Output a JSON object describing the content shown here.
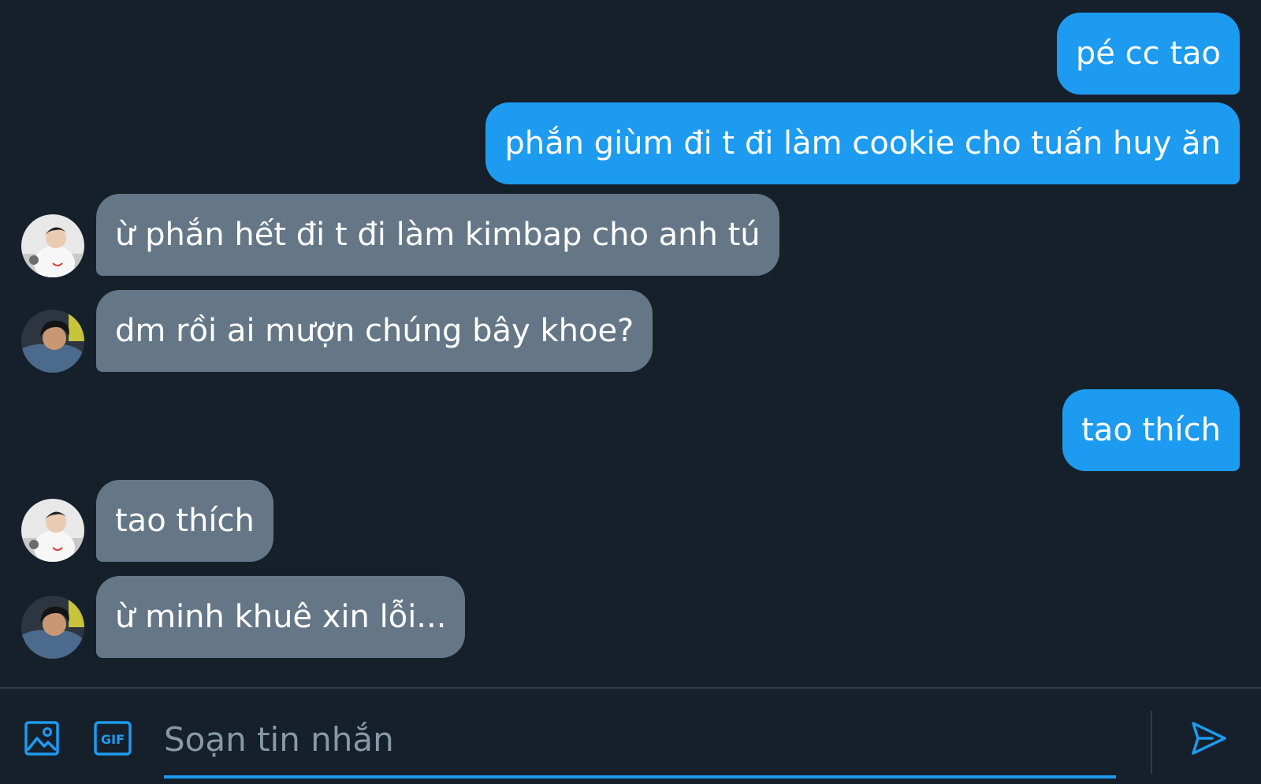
{
  "colors": {
    "background": "#15202b",
    "outgoing": "#1d9bf0",
    "incoming": "#657786",
    "accent": "#1d9bf0"
  },
  "messages": [
    {
      "direction": "out",
      "text": "pé cc tao"
    },
    {
      "direction": "out",
      "text": "phắn giùm đi t đi làm cookie cho tuấn huy ăn"
    },
    {
      "direction": "in",
      "avatar": "avatar-white-shirt",
      "text": "ừ phắn hết đi t đi làm kimbap cho anh tú"
    },
    {
      "direction": "in",
      "avatar": "avatar-denim-jacket",
      "text": "dm rồi ai mượn chúng bây khoe?"
    },
    {
      "direction": "out",
      "text": "tao thích"
    },
    {
      "direction": "in",
      "avatar": "avatar-white-shirt",
      "text": "tao thích"
    },
    {
      "direction": "in",
      "avatar": "avatar-denim-jacket",
      "text": "ừ minh khuê xin lỗi..."
    }
  ],
  "composer": {
    "placeholder": "Soạn tin nhắn",
    "value": "",
    "icons": {
      "image": "image-icon",
      "gif": "gif-icon",
      "send": "send-icon"
    },
    "gif_label": "GIF"
  }
}
